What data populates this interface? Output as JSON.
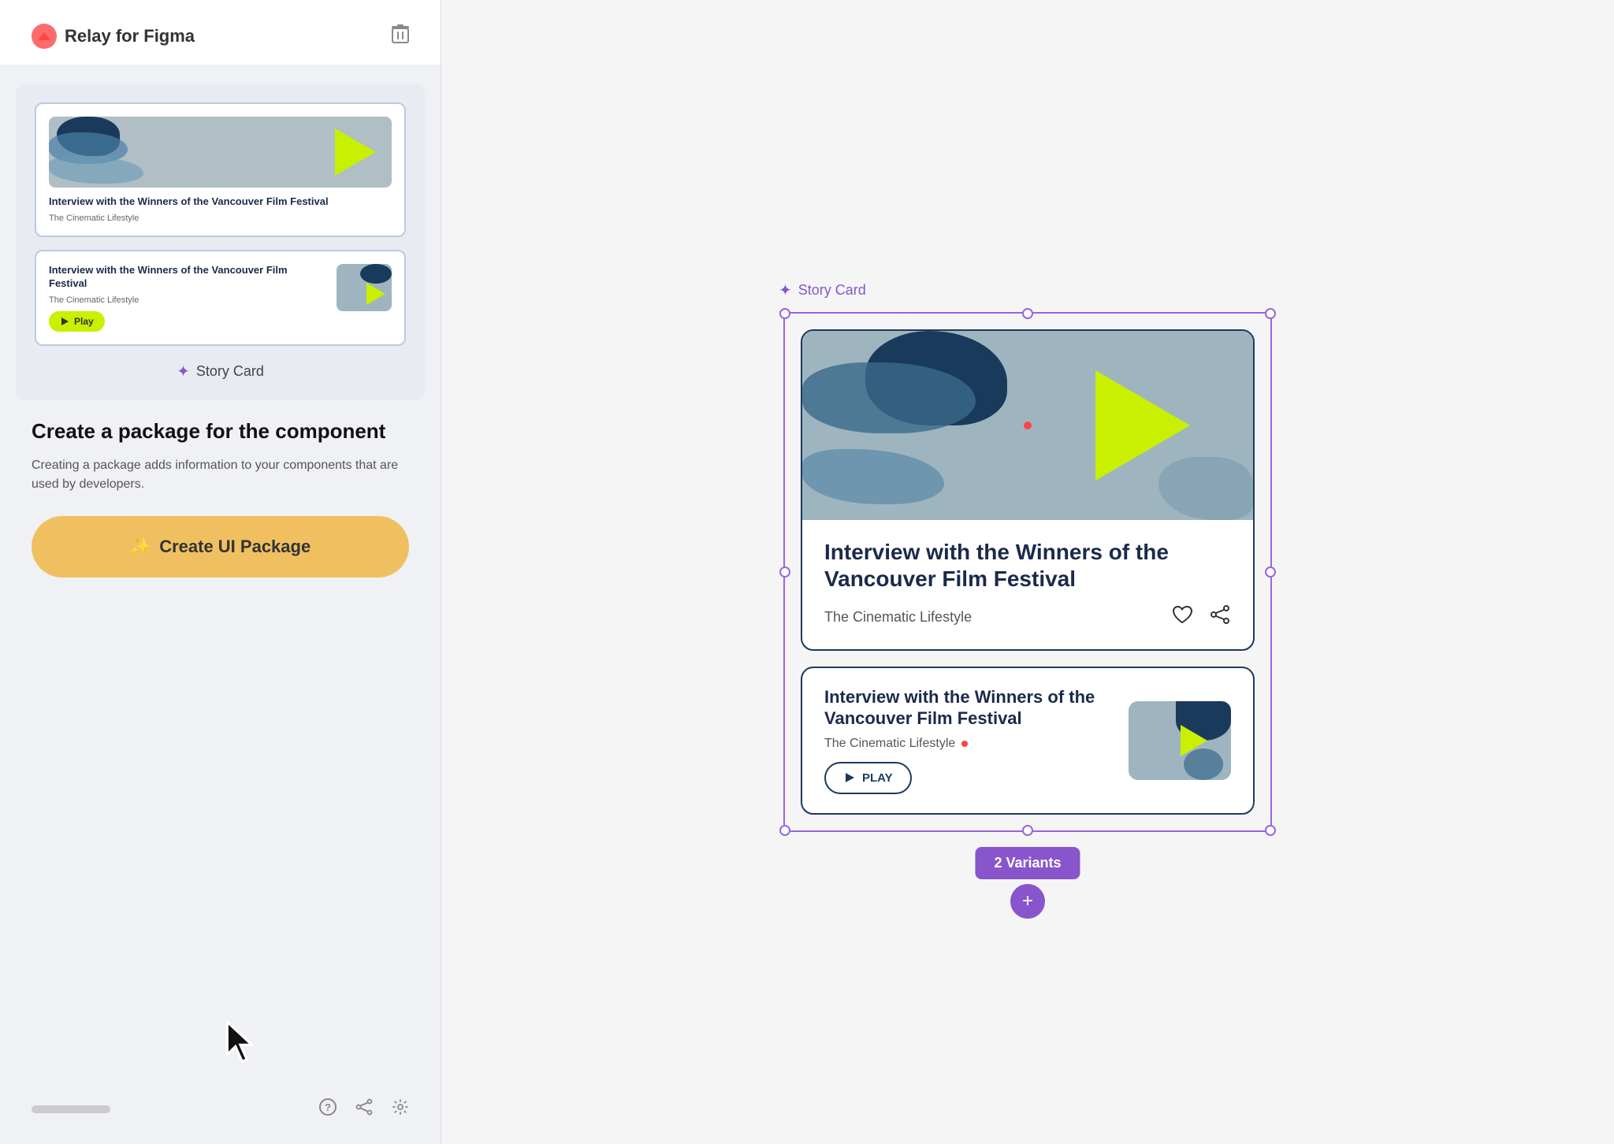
{
  "app": {
    "brand_name": "Relay for Figma",
    "brand_icon": "🎨"
  },
  "left_panel": {
    "component_label": "Story Card",
    "description_title": "Create a package for the component",
    "description_text": "Creating a package adds information to your components that are used by developers.",
    "create_btn_label": "Create UI Package",
    "create_btn_icon": "✨"
  },
  "right_panel": {
    "figma_label": "Story Card",
    "card1": {
      "title": "Interview with the Winners of the Vancouver Film Festival",
      "subtitle": "The Cinematic Lifestyle"
    },
    "card2": {
      "title": "Interview with the Winners of the Vancouver Film Festival",
      "subtitle": "The Cinematic Lifestyle",
      "play_label": "PLAY"
    },
    "variants_badge": "2 Variants"
  },
  "footer": {
    "help_icon": "?",
    "share_icon": "share",
    "settings_icon": "⚙"
  }
}
